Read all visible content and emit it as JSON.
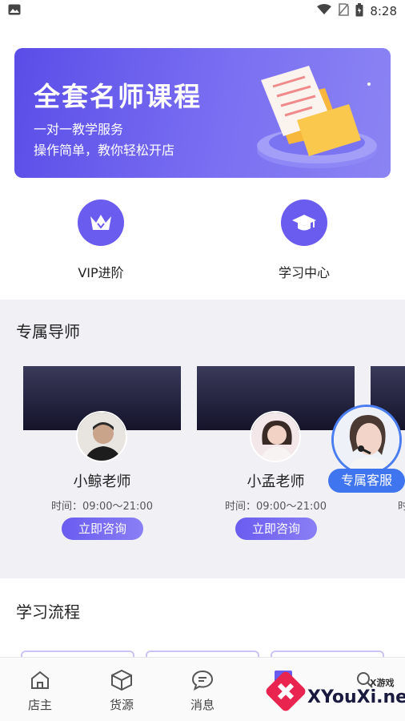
{
  "status_bar": {
    "time": "8:28"
  },
  "banner": {
    "title": "全套名师课程",
    "subtitle1": "一对一教学服务",
    "subtitle2": "操作简单，教你轻松开店"
  },
  "nav": [
    {
      "label": "VIP进阶",
      "icon": "crown-icon"
    },
    {
      "label": "学习中心",
      "icon": "graduation-cap-icon"
    }
  ],
  "mentors": {
    "title": "专属导师",
    "items": [
      {
        "name": "小鲸老师",
        "time": "时间：09:00～21:00",
        "button": "立即咨询"
      },
      {
        "name": "小孟老师",
        "time": "时间：09:00～21:00",
        "button": "立即咨询"
      }
    ],
    "partial_time_glyph": "时"
  },
  "service": {
    "label": "专属客服"
  },
  "flow": {
    "title": "学习流程"
  },
  "tabs": [
    {
      "label": "店主",
      "icon": "home-icon"
    },
    {
      "label": "货源",
      "icon": "box-icon"
    },
    {
      "label": "消息",
      "icon": "chat-icon"
    },
    {
      "label": "",
      "icon": "profile-icon"
    },
    {
      "label": "",
      "icon": "search-icon"
    }
  ],
  "watermark": {
    "text": "XYouXi.net",
    "small": "X游戏"
  },
  "colors": {
    "accent": "#6b5cf0",
    "service_blue": "#3f75ee",
    "section_bg": "#f1f1f5"
  }
}
